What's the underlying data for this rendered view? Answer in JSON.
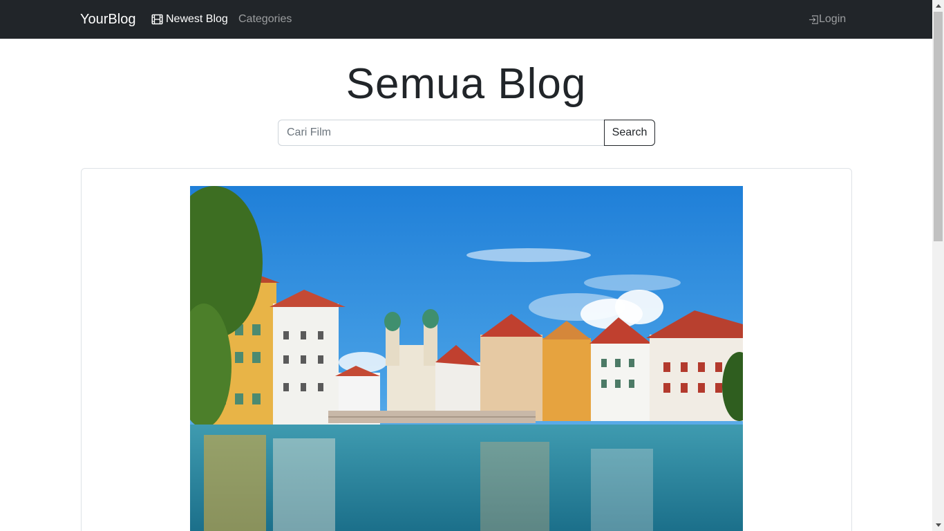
{
  "navbar": {
    "brand": "YourBlog",
    "newest_label": "Newest Blog",
    "categories_label": "Categories",
    "login_label": "Login",
    "newest_icon": "film-icon",
    "login_icon": "login-icon"
  },
  "main": {
    "title": "Semua Blog"
  },
  "search": {
    "placeholder": "Cari Film",
    "value": "",
    "button_label": "Search"
  },
  "colors": {
    "navbar_bg": "#212529",
    "nav_active": "#ffffff",
    "nav_muted": "rgba(255,255,255,0.55)",
    "card_border": "#dee2e6"
  }
}
